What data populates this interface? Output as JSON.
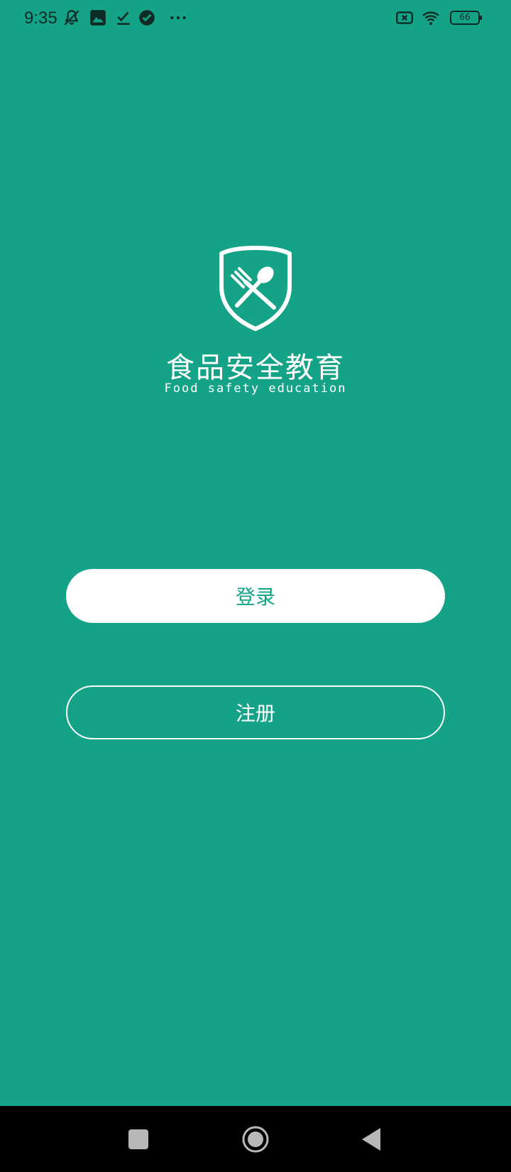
{
  "status_bar": {
    "time": "9:35",
    "battery_level": "66",
    "icons": [
      "notification-muted-icon",
      "gallery-icon",
      "download-done-icon",
      "check-circle-icon",
      "more-dots-icon",
      "sim-disabled-icon",
      "wifi-icon",
      "battery-icon"
    ]
  },
  "app": {
    "title_cn": "食品安全教育",
    "title_en": "Food safety education",
    "logo_icon": "shield-fork-spoon-icon"
  },
  "buttons": {
    "login_label": "登录",
    "register_label": "注册"
  },
  "nav_bar": {
    "icons": [
      "recents-square-icon",
      "home-circle-icon",
      "back-triangle-icon"
    ]
  },
  "colors": {
    "background": "#14a387",
    "button_primary_bg": "#ffffff",
    "button_primary_text": "#14a387",
    "nav_bar": "#000000"
  }
}
